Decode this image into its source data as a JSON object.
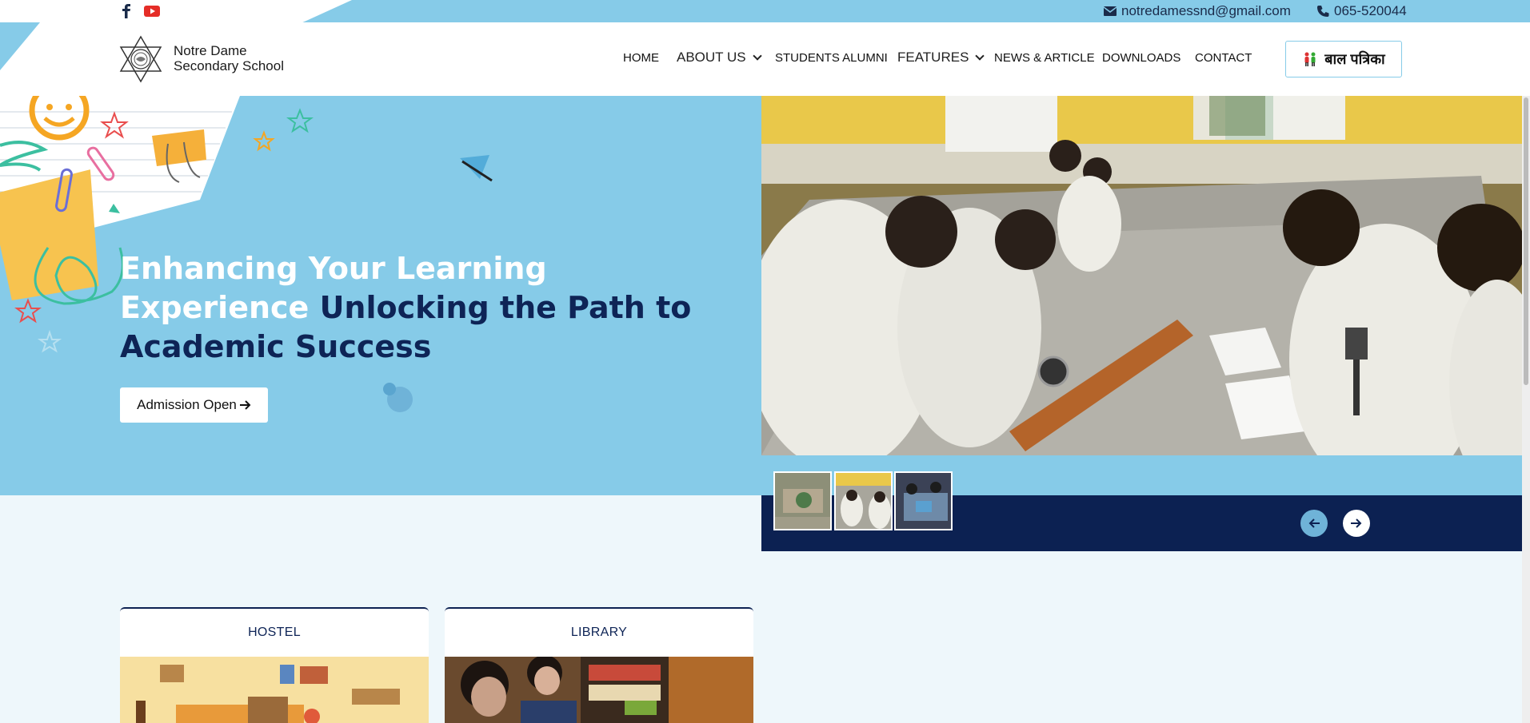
{
  "topbar": {
    "email": "notredamessnd@gmail.com",
    "phone": "065-520044",
    "social": [
      "facebook-icon",
      "youtube-icon"
    ]
  },
  "header": {
    "school_name_line1": "Notre Dame",
    "school_name_line2": "Secondary School",
    "nav": [
      {
        "label": "HOME"
      },
      {
        "label": "ABOUT US",
        "dropdown": true
      },
      {
        "label": "STUDENTS ALUMNI"
      },
      {
        "label": "FEATURES",
        "dropdown": true
      },
      {
        "label": "NEWS & ARTICLE"
      },
      {
        "label": "DOWNLOADS"
      },
      {
        "label": "CONTACT"
      }
    ],
    "bal_patrika": "बाल पत्रिका"
  },
  "hero": {
    "title_light": "Enhancing Your Learning Experience",
    "title_dark": "Unlocking the Path to Academic Success",
    "cta": "Admission Open"
  },
  "cards": [
    {
      "title": "HOSTEL"
    },
    {
      "title": "LIBRARY"
    }
  ],
  "colors": {
    "sky": "#86cbe8",
    "navy": "#0c2152",
    "background": "#eef7fb"
  }
}
